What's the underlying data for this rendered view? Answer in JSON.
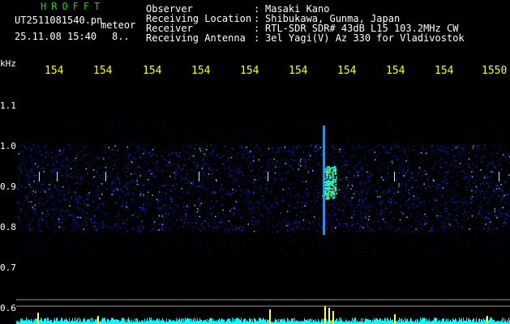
{
  "header": {
    "app_title": "HROFFT",
    "file_name": "UT2511081540.pn",
    "file_tag": "meteor",
    "date_time": "25.11.08 15:40",
    "date_extra": "8.."
  },
  "info": [
    {
      "label": "Observer",
      "sep": ":",
      "value": "Masaki Kano"
    },
    {
      "label": "Receiving Location",
      "sep": ":",
      "value": "Shibukawa, Gunma, Japan"
    },
    {
      "label": "Receiver",
      "sep": ":",
      "value": "RTL-SDR SDR# 43dB L15 103.2MHz CW"
    },
    {
      "label": "Receiving Antenna",
      "sep": ":",
      "value": "3el Yagi(V) Az 330 for Vladivostok"
    }
  ],
  "axis": {
    "y_unit": "kHz",
    "x_ticks": [
      "154",
      "154",
      "154",
      "154",
      "154",
      "154",
      "154",
      "154",
      "154",
      "1550"
    ],
    "y_ticks": [
      "1.1",
      "1.0",
      "0.9",
      "0.8",
      "0.7",
      "0.6"
    ]
  },
  "colors": {
    "background": "#000000",
    "title_green": "#00e000",
    "tick_yellow": "#ffff00",
    "noise_blue": "#1a2cff",
    "signal_cyan": "#00ffff",
    "signal_red": "#ff2020"
  }
}
